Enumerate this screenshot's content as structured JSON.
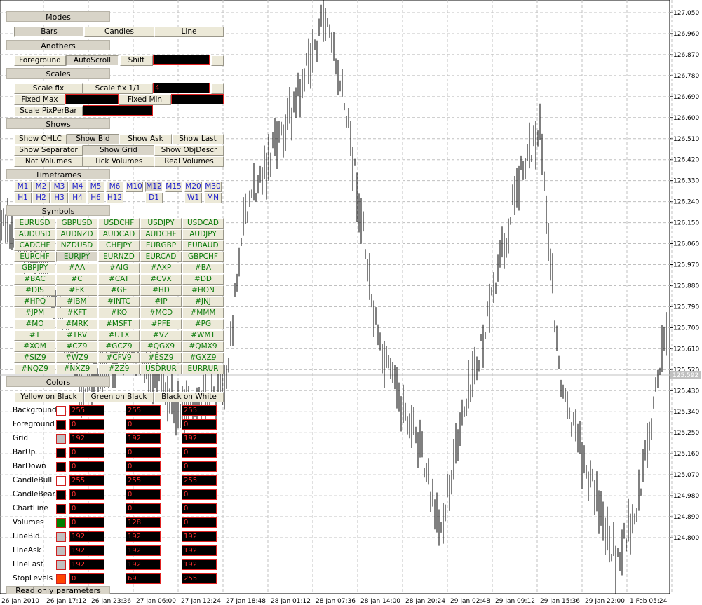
{
  "panel": {
    "modes": {
      "title": "Modes",
      "buttons": [
        "Bars",
        "Candles",
        "Line"
      ]
    },
    "anothers": {
      "title": "Anothers",
      "foreground": "Foreground",
      "autoscroll": "AutoScroll",
      "shift": "Shift",
      "shift_value": ""
    },
    "scales": {
      "title": "Scales",
      "scale_fix": "Scale fix",
      "scale_fix_11": "Scale fix 1/1",
      "scale_value": "4",
      "fixed_max": "Fixed Max",
      "fixed_min": "Fixed Min",
      "scale_pix": "Scale PixPerBar"
    },
    "shows": {
      "title": "Shows",
      "row1": [
        "Show OHLC",
        "Show Bid",
        "Show Ask",
        "Show Last"
      ],
      "row2": [
        "Show Separator",
        "Show Grid",
        "Show ObjDescr"
      ],
      "row3": [
        "Not Volumes",
        "Tick Volumes",
        "Real Volumes"
      ]
    },
    "timeframes": {
      "title": "Timeframes",
      "row1": [
        "M1",
        "M2",
        "M3",
        "M4",
        "M5",
        "M6",
        "M10",
        "M12",
        "M15",
        "M20",
        "M30"
      ],
      "row2": [
        "H1",
        "H2",
        "H3",
        "H4",
        "H6",
        "H12",
        "D1",
        "W1",
        "MN"
      ]
    },
    "symbols": {
      "title": "Symbols",
      "list": [
        "EURUSD",
        "GBPUSD",
        "USDCHF",
        "USDJPY",
        "USDCAD",
        "AUDUSD",
        "AUDNZD",
        "AUDCAD",
        "AUDCHF",
        "AUDJPY",
        "CADCHF",
        "NZDUSD",
        "CHFJPY",
        "EURGBP",
        "EURAUD",
        "EURCHF",
        "EURJPY",
        "EURNZD",
        "EURCAD",
        "GBPCHF",
        "GBPJPY",
        "#AA",
        "#AIG",
        "#AXP",
        "#BA",
        "#BAC",
        "#C",
        "#CAT",
        "#CVX",
        "#DD",
        "#DIS",
        "#EK",
        "#GE",
        "#HD",
        "#HON",
        "#HPQ",
        "#IBM",
        "#INTC",
        "#IP",
        "#JNJ",
        "#JPM",
        "#KFT",
        "#KO",
        "#MCD",
        "#MMM",
        "#MO",
        "#MRK",
        "#MSFT",
        "#PFE",
        "#PG",
        "#T",
        "#TRV",
        "#UTX",
        "#VZ",
        "#WMT",
        "#XOM",
        "#CZ9",
        "#GCZ9",
        "#QGX9",
        "#QMX9",
        "#SIZ9",
        "#WZ9",
        "#CFV9",
        "#ESZ9",
        "#GXZ9",
        "#NQZ9",
        "#NXZ9",
        "#ZZ9",
        "USDRUR",
        "EURRUR"
      ]
    },
    "colors": {
      "title": "Colors",
      "presets": [
        "Yellow on Black",
        "Green on Black",
        "Black on White"
      ],
      "rows": [
        {
          "label": "Background",
          "swatch": "#ffffff",
          "r": "255",
          "g": "255",
          "b": "255"
        },
        {
          "label": "Foreground",
          "swatch": "#000000",
          "r": "0",
          "g": "0",
          "b": "0"
        },
        {
          "label": "Grid",
          "swatch": "#c0c0c0",
          "r": "192",
          "g": "192",
          "b": "192"
        },
        {
          "label": "BarUp",
          "swatch": "#000000",
          "r": "0",
          "g": "0",
          "b": "0"
        },
        {
          "label": "BarDown",
          "swatch": "#000000",
          "r": "0",
          "g": "0",
          "b": "0"
        },
        {
          "label": "CandleBull",
          "swatch": "#ffffff",
          "r": "255",
          "g": "255",
          "b": "255"
        },
        {
          "label": "CandleBear",
          "swatch": "#000000",
          "r": "0",
          "g": "0",
          "b": "0"
        },
        {
          "label": "ChartLine",
          "swatch": "#000000",
          "r": "0",
          "g": "0",
          "b": "0"
        },
        {
          "label": "Volumes",
          "swatch": "#008000",
          "r": "0",
          "g": "128",
          "b": "0"
        },
        {
          "label": "LineBid",
          "swatch": "#c0c0c0",
          "r": "192",
          "g": "192",
          "b": "192"
        },
        {
          "label": "LineAsk",
          "swatch": "#c0c0c0",
          "r": "192",
          "g": "192",
          "b": "192"
        },
        {
          "label": "LineLast",
          "swatch": "#c0c0c0",
          "r": "192",
          "g": "192",
          "b": "192"
        },
        {
          "label": "StopLevels",
          "swatch": "#ff4500",
          "r": "0",
          "g": "69",
          "b": "255"
        }
      ]
    },
    "readonly": {
      "title": "Read only parameters"
    }
  },
  "price_axis": [
    "127.050",
    "126.960",
    "126.870",
    "126.780",
    "126.690",
    "126.600",
    "126.510",
    "126.420",
    "126.330",
    "126.240",
    "126.150",
    "126.060",
    "125.970",
    "125.880",
    "125.790",
    "125.700",
    "125.610",
    "125.520",
    "125.430",
    "125.340",
    "125.250",
    "125.160",
    "125.070",
    "124.980",
    "124.890",
    "124.800"
  ],
  "current_price": "125.592",
  "time_axis": [
    "26 Jan 2010",
    "26 Jan 17:12",
    "26 Jan 23:36",
    "27 Jan 06:00",
    "27 Jan 12:24",
    "27 Jan 18:48",
    "28 Jan 01:12",
    "28 Jan 07:36",
    "28 Jan 14:00",
    "28 Jan 20:24",
    "29 Jan 02:48",
    "29 Jan 09:12",
    "29 Jan 15:36",
    "29 Jan 22:00",
    "1 Feb 05:24"
  ],
  "colors": {
    "panel_bg": "#ece9d8",
    "header_bg": "#d8d4c8",
    "timeframe_text": "#1a1acc",
    "symbol_text": "#0a7a0a",
    "input_border": "#e02020",
    "input_text": "#ff3030",
    "grid": "#c0c0c0"
  }
}
